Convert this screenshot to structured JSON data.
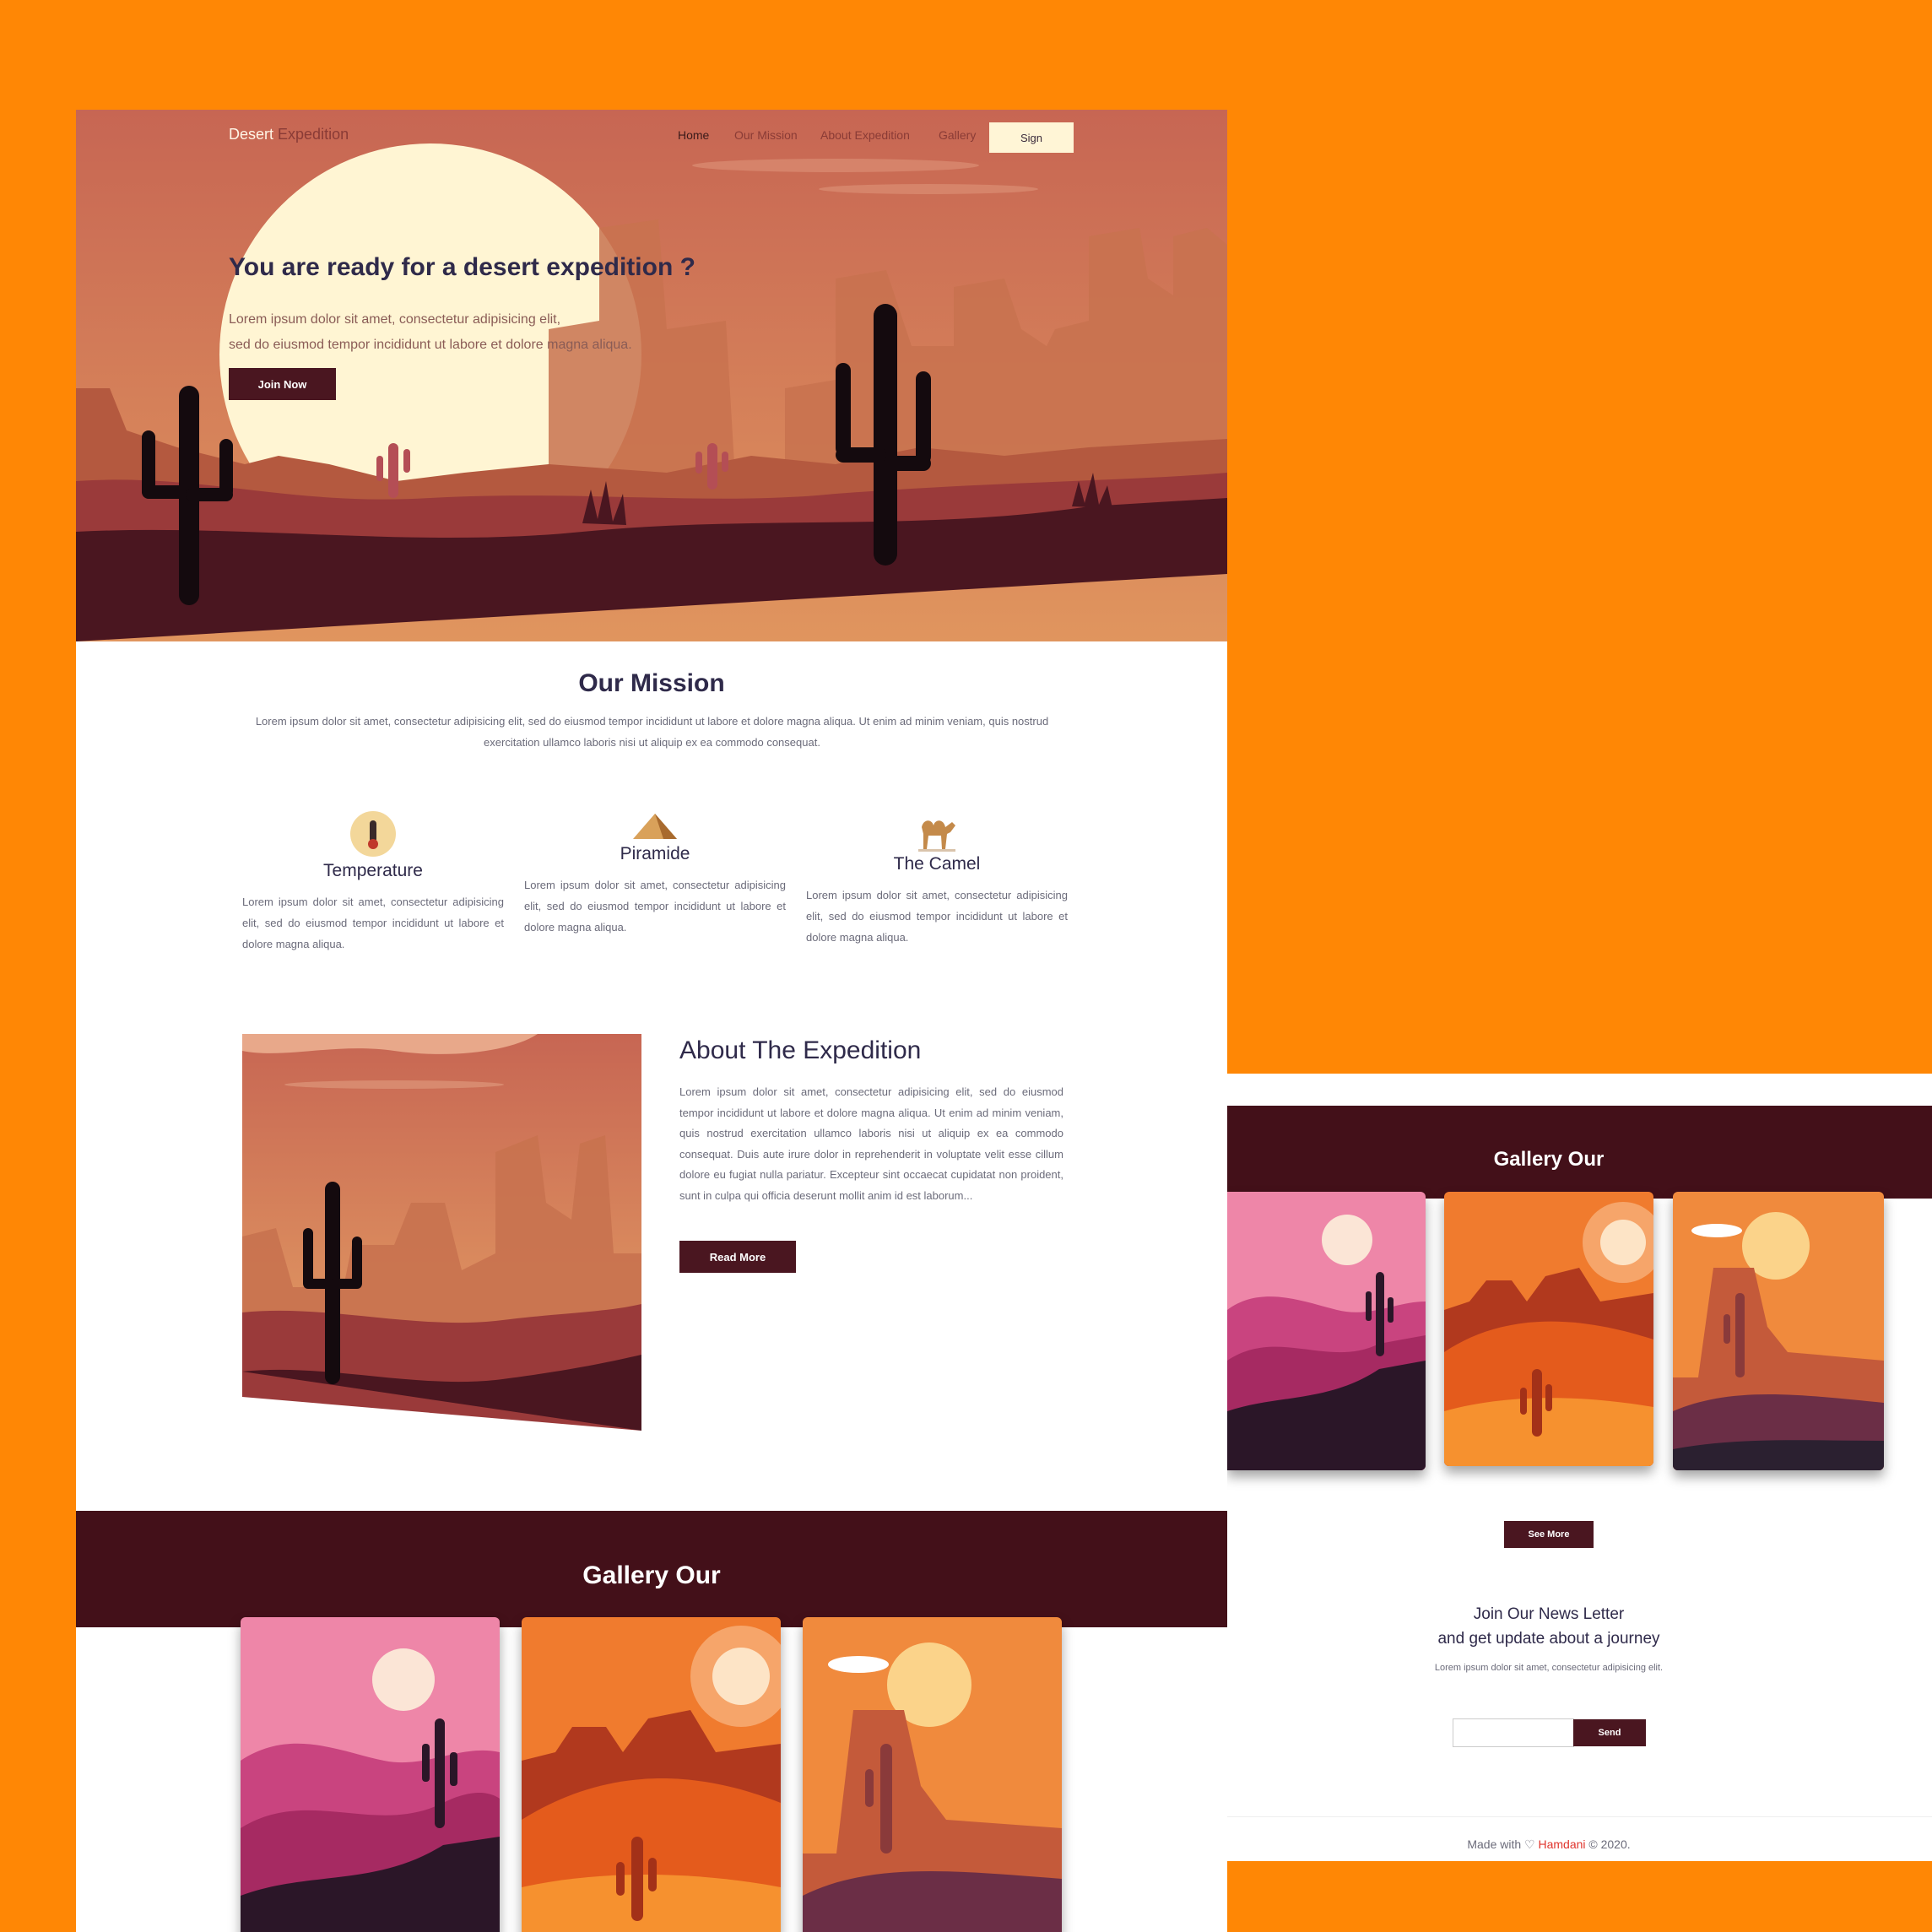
{
  "nav": {
    "brand_first": "Desert",
    "brand_second": "Expedition",
    "links": [
      "Home",
      "Our Mission",
      "About Expedition",
      "Gallery"
    ],
    "sign_label": "Sign"
  },
  "hero": {
    "title": "You are ready for a desert expedition ?",
    "text_line1": "Lorem ipsum dolor sit amet, consectetur adipisicing elit,",
    "text_line2": "sed do eiusmod tempor incididunt ut labore et dolore magna aliqua.",
    "join_label": "Join Now"
  },
  "mission": {
    "title": "Our Mission",
    "text": "Lorem ipsum dolor sit amet, consectetur adipisicing elit, sed do eiusmod tempor incididunt ut labore et dolore magna aliqua. Ut enim ad minim veniam, quis nostrud exercitation ullamco laboris nisi ut aliquip ex ea commodo consequat.",
    "features": [
      {
        "title": "Temperature",
        "icon": "thermometer-icon",
        "text": "Lorem ipsum dolor sit amet, consectetur adipisicing elit, sed do eiusmod tempor incididunt ut labore et dolore magna aliqua."
      },
      {
        "title": "Piramide",
        "icon": "pyramid-icon",
        "text": "Lorem ipsum dolor sit amet, consectetur adipisicing elit, sed do eiusmod tempor incididunt ut labore et dolore magna aliqua."
      },
      {
        "title": "The Camel",
        "icon": "camel-icon",
        "text": "Lorem ipsum dolor sit amet, consectetur adipisicing elit, sed do eiusmod tempor incididunt ut labore et dolore magna aliqua."
      }
    ]
  },
  "about": {
    "title": "About The Expedition",
    "text": "Lorem ipsum dolor sit amet, consectetur adipisicing elit, sed do eiusmod tempor incididunt ut labore et dolore magna aliqua. Ut enim ad minim veniam, quis nostrud exercitation ullamco laboris nisi ut aliquip ex ea commodo consequat. Duis aute irure dolor in reprehenderit in voluptate velit esse cillum dolore eu fugiat nulla pariatur. Excepteur sint occaecat cupidatat non proident, sunt in culpa qui officia deserunt mollit anim id est laborum...",
    "read_label": "Read More"
  },
  "gallery": {
    "title": "Gallery Our",
    "see_more_label": "See More"
  },
  "newsletter": {
    "title_line1": "Join Our News Letter",
    "title_line2": "and get update about a journey",
    "text": "Lorem ipsum dolor sit amet, consectetur adipisicing elit.",
    "input_value": "",
    "send_label": "Send"
  },
  "footer": {
    "prefix": "Made with",
    "author": "Hamdani",
    "suffix": "© 2020."
  },
  "colors": {
    "background": "#ff8705",
    "accent_dark": "#431019",
    "heading": "#2f2a4a",
    "footer_author": "#e0342c"
  }
}
